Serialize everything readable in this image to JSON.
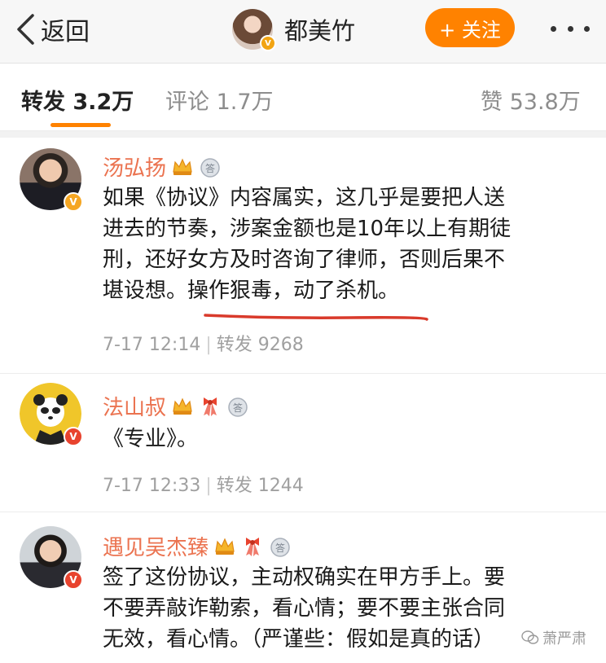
{
  "nav": {
    "back_label": "返回",
    "title": "都美竹",
    "follow_label": "+ 关注"
  },
  "tabs": {
    "repost": "转发 3.2万",
    "comment": "评论 1.7万",
    "like": "赞 53.8万",
    "active": "repost"
  },
  "comments": [
    {
      "user": "汤弘扬",
      "verified": "gold",
      "text_lines": [
        "如果《协议》内容属实，这几乎是要把人送",
        "进去的节奏，涉案金额也是10年以上有期徒",
        "刑，还好女方及时咨询了律师，否则后果不"
      ],
      "text_tail_plain": "堪设想。",
      "text_tail_highlight": "操作狠毒，动了杀机",
      "text_tail_end": "。",
      "time": "7-17 12:14",
      "repost": "转发 9268"
    },
    {
      "user": "法山叔",
      "verified": "red",
      "text": "《专业》。",
      "time": "7-17 12:33",
      "repost": "转发 1244"
    },
    {
      "user": "遇见吴杰臻",
      "verified": "red",
      "text_lines": [
        "签了这份协议，主动权确实在甲方手上。要",
        "不要弄敲诈勒索，看心情；要不要主张合同",
        "无效，看心情。（严谨些：假如是真的话）"
      ]
    }
  ],
  "watermark": "萧严肃",
  "colors": {
    "accent": "#ff8200",
    "username": "#eb7350",
    "highlight_underline": "#d93a2b"
  }
}
